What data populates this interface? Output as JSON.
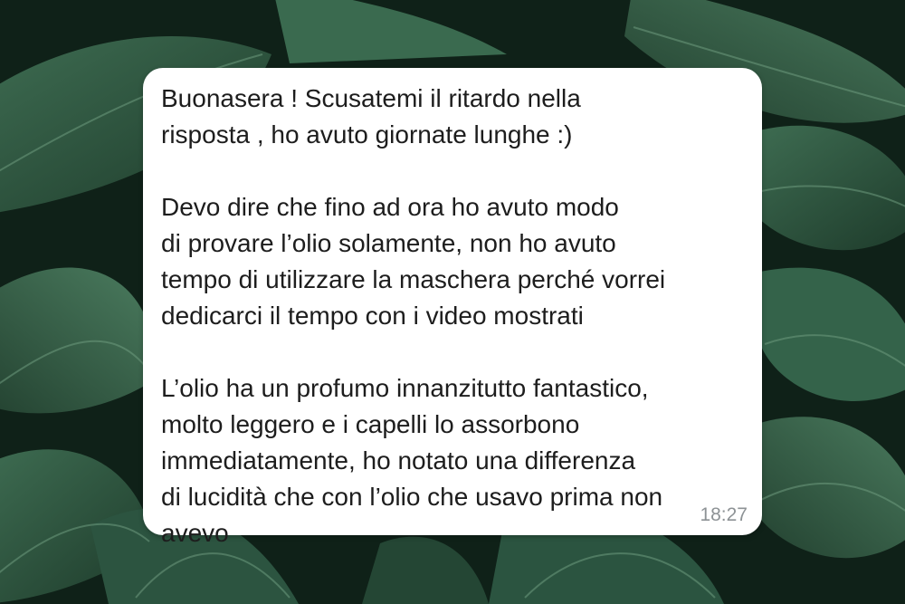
{
  "background": {
    "description_icon": "monstera-leaves-background",
    "colors": {
      "dark": "#0f2118",
      "leaf": "#2f5a41",
      "leaf_light": "#4a7a5c",
      "vein": "#6e9a7e"
    }
  },
  "message": {
    "paragraphs": [
      "Buonasera ! Scusatemi il ritardo nella\nrisposta , ho avuto giornate lunghe :)",
      "Devo dire che fino ad ora ho avuto modo\ndi provare l’olio solamente, non ho avuto\ntempo di utilizzare la maschera perché vorrei\ndedicarci il tempo con i video mostrati",
      "L’olio ha un profumo innanzitutto fantastico,\nmolto leggero e i capelli lo assorbono\nimmediatamente, ho notato una differenza\ndi lucidità che con l’olio che usavo prima non\navevo"
    ],
    "time": "18:27",
    "bubble_color": "#ffffff",
    "text_color": "#1d1d1d",
    "time_color": "#8d9295"
  }
}
